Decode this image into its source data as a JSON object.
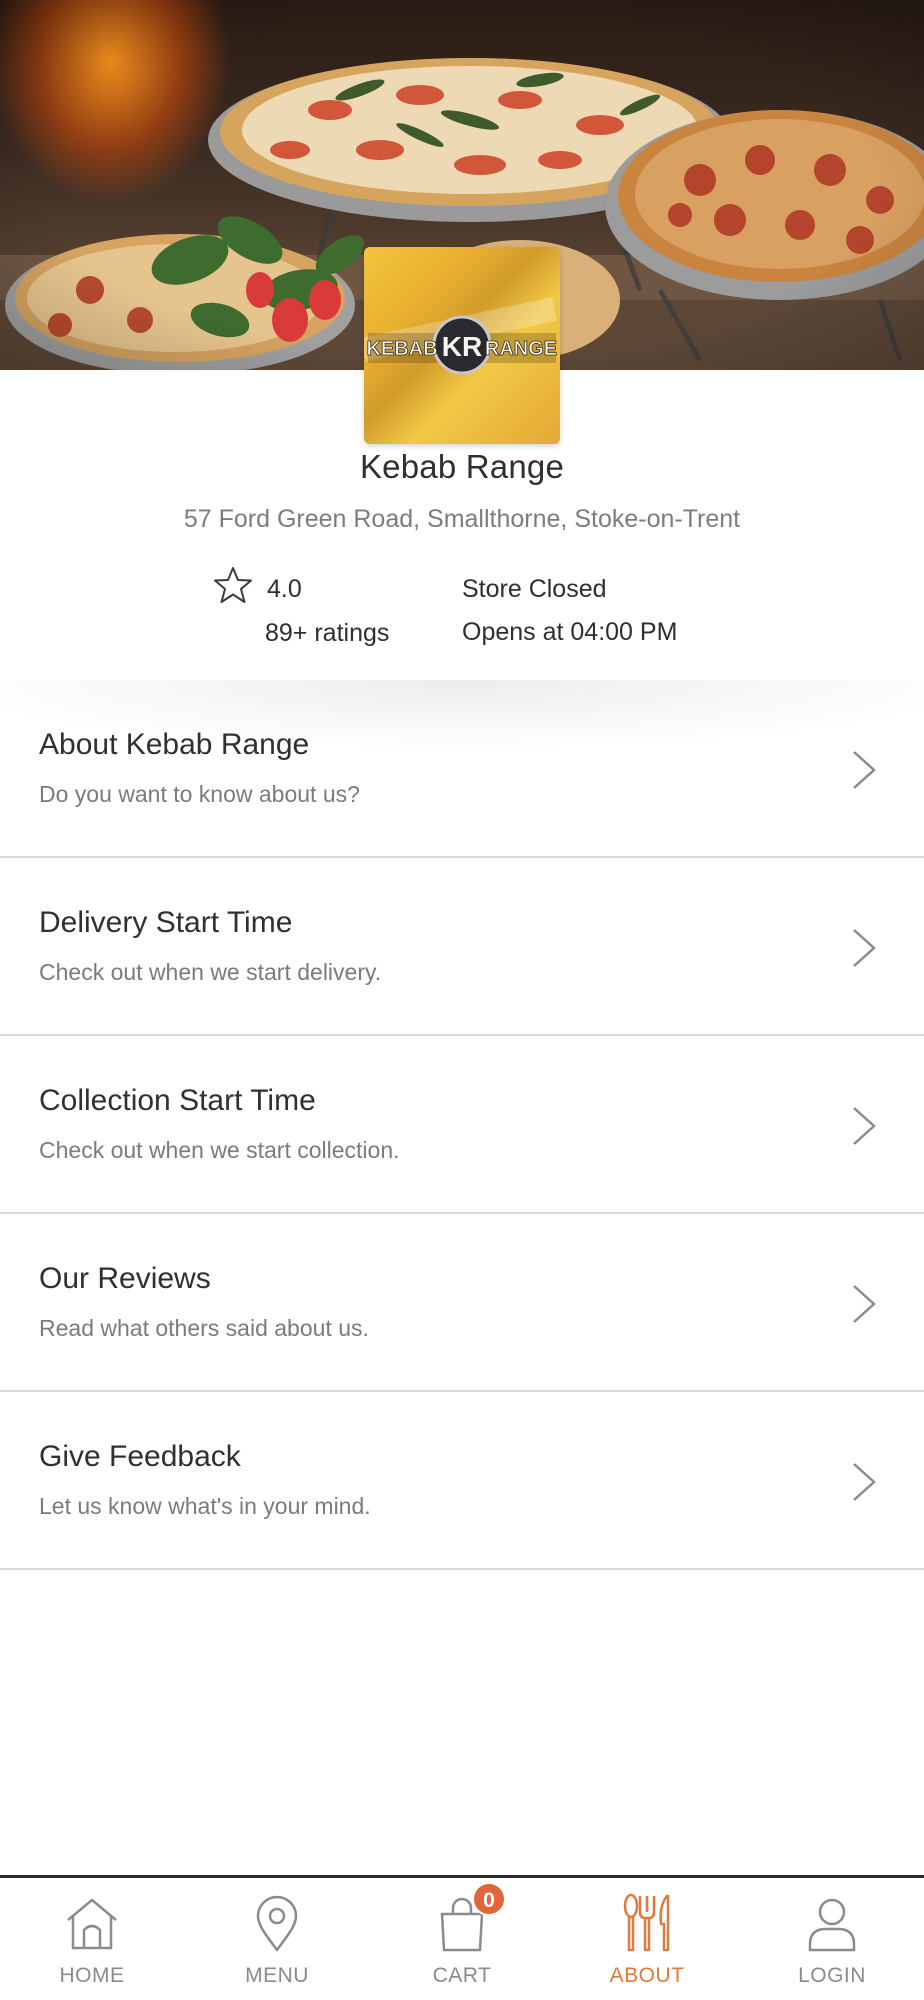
{
  "store": {
    "name": "Kebab Range",
    "address": "57 Ford Green Road, Smallthorne, Stoke-on-Trent",
    "logo_text_left": "KEBAB",
    "logo_text_mark": "KR",
    "logo_text_right": "RANGE",
    "rating": "4.0",
    "ratings_count": "89+ ratings",
    "status": "Store Closed",
    "opens": "Opens at 04:00 PM"
  },
  "menu": {
    "items": [
      {
        "title": "About Kebab Range",
        "subtitle": "Do you want to know about us?"
      },
      {
        "title": "Delivery Start Time",
        "subtitle": "Check out when we start delivery."
      },
      {
        "title": "Collection Start Time",
        "subtitle": "Check out when we start collection."
      },
      {
        "title": "Our Reviews",
        "subtitle": "Read what others said about us."
      },
      {
        "title": "Give Feedback",
        "subtitle": "Let us know what's in your mind."
      }
    ]
  },
  "nav": {
    "home": "HOME",
    "menu": "MENU",
    "cart": "CART",
    "cart_count": "0",
    "about": "ABOUT",
    "login": "LOGIN",
    "active": "about"
  },
  "colors": {
    "accent": "#e07a3d",
    "badge": "#e0663c",
    "logo_gold": "#f2c43f"
  }
}
